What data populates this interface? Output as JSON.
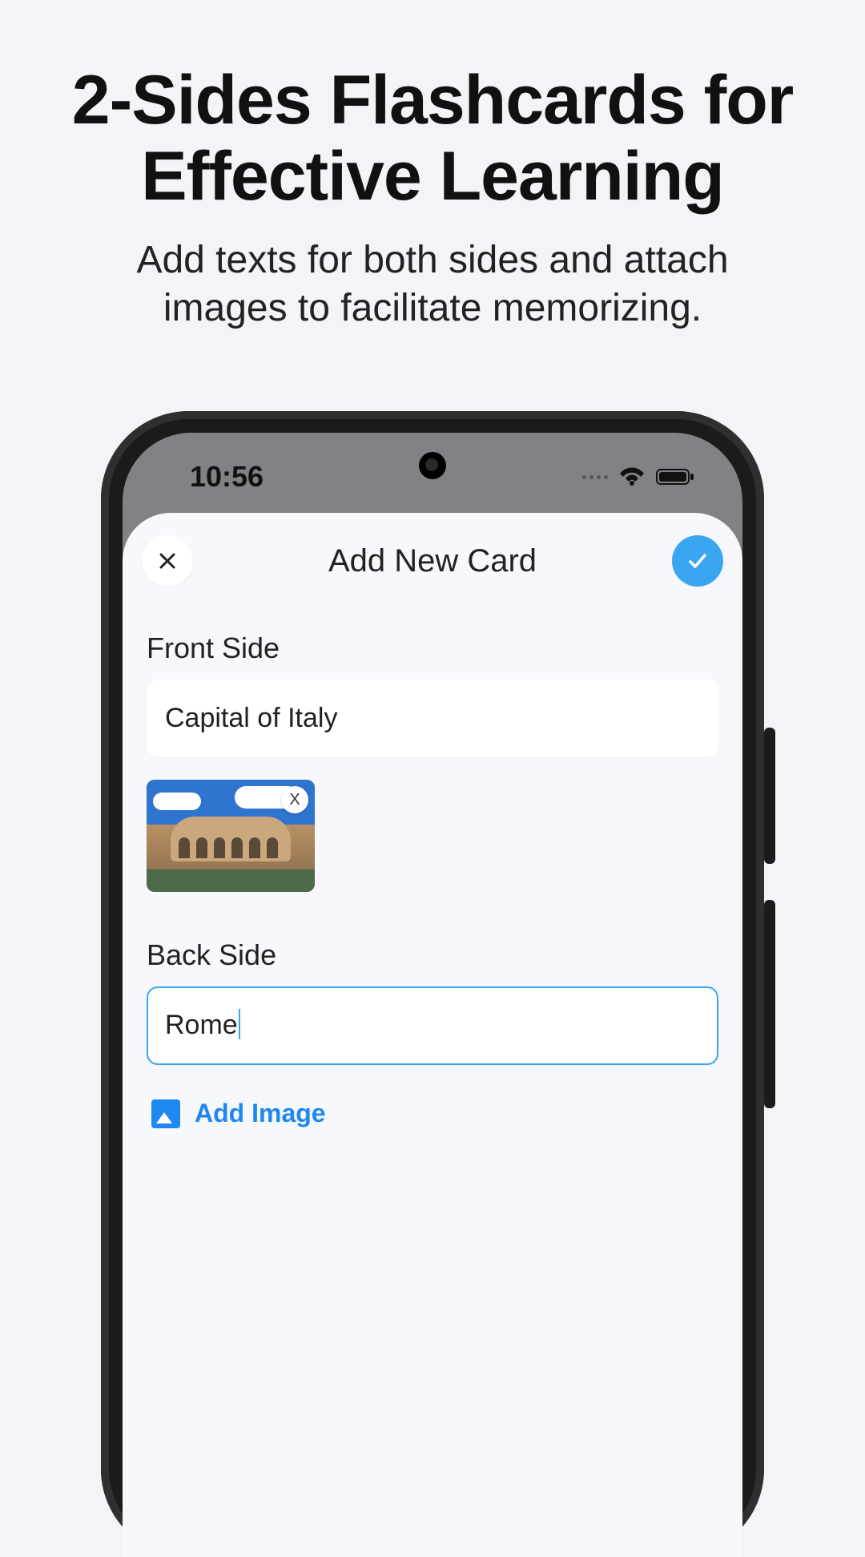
{
  "promo": {
    "headline_line1": "2-Sides Flashcards for",
    "headline_line2": "Effective Learning",
    "subhead": "Add texts for both sides and attach images to facilitate memorizing."
  },
  "status": {
    "time": "10:56"
  },
  "header": {
    "title": "Add New Card"
  },
  "front": {
    "label": "Front Side",
    "value": "Capital of Italy",
    "image_alt": "Colosseum",
    "remove_label": "X"
  },
  "back": {
    "label": "Back Side",
    "value": "Rome",
    "add_image_label": "Add Image"
  },
  "colors": {
    "accent": "#3aa6f2"
  }
}
